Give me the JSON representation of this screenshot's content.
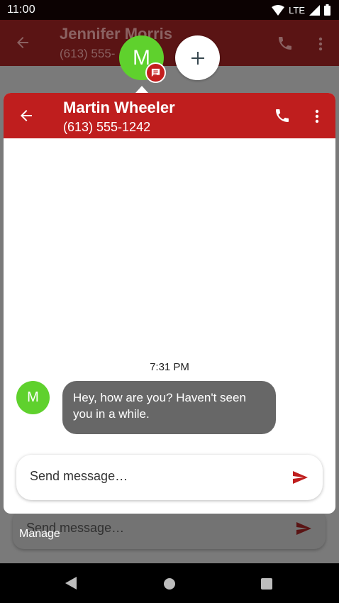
{
  "status_bar": {
    "time": "11:00",
    "network": "LTE"
  },
  "background_conversation": {
    "contact_name": "Jennifer Morris",
    "phone": "(613) 555-",
    "compose_placeholder": "Send message…"
  },
  "bubbles": {
    "contact_initial": "M",
    "manage_label": "Manage"
  },
  "chat": {
    "contact_name": "Martin Wheeler",
    "phone": "(613) 555-1242",
    "timestamp": "7:31 PM",
    "messages": [
      {
        "sender_initial": "M",
        "text": "Hey, how are you? Haven't seen you in a while."
      }
    ],
    "compose_placeholder": "Send message…"
  },
  "colors": {
    "accent": "#bf1e1e",
    "avatar": "#5fd12d",
    "incoming_bubble": "#676767"
  },
  "icons": [
    "wifi-icon",
    "signal-icon",
    "battery-icon",
    "back-arrow-icon",
    "phone-icon",
    "more-vert-icon",
    "message-badge-icon",
    "add-icon",
    "send-icon",
    "nav-back-icon",
    "nav-home-icon",
    "nav-recents-icon"
  ]
}
